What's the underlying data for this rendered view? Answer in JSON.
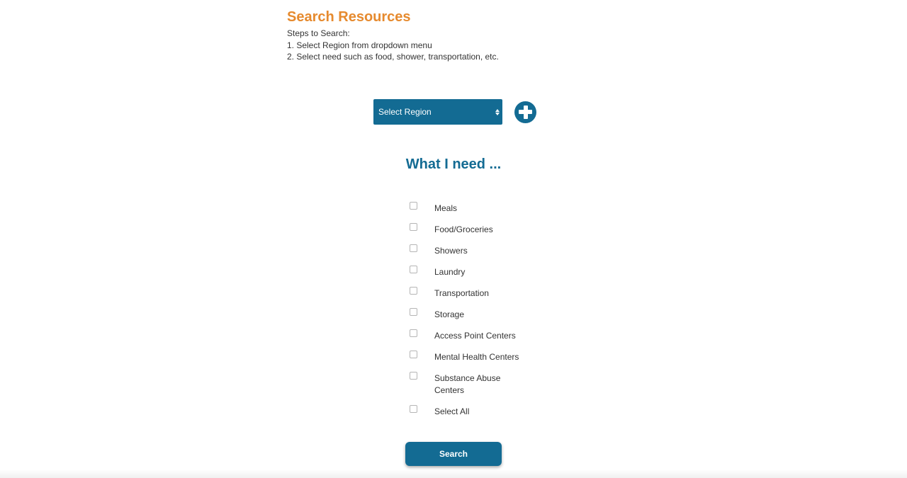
{
  "header": {
    "title": "Search Resources",
    "steps_heading": "Steps to Search:",
    "step_1": "1. Select Region from dropdown menu",
    "step_2": "2. Select need such as food, shower, transportation, etc."
  },
  "region_select": {
    "selected_value": "Select Region"
  },
  "icons": {
    "add": "plus-circle-icon",
    "select_arrows": "sort-arrows-icon"
  },
  "needs": {
    "title": "What I need ...",
    "items": [
      {
        "label": "Meals",
        "checked": false
      },
      {
        "label": "Food/Groceries",
        "checked": false
      },
      {
        "label": "Showers",
        "checked": false
      },
      {
        "label": "Laundry",
        "checked": false
      },
      {
        "label": "Transportation",
        "checked": false
      },
      {
        "label": "Storage",
        "checked": false
      },
      {
        "label": "Access Point Centers",
        "checked": false
      },
      {
        "label": "Mental Health Centers",
        "checked": false
      },
      {
        "label": "Substance Abuse Centers",
        "checked": false
      },
      {
        "label": "Select All",
        "checked": false
      }
    ]
  },
  "actions": {
    "search_label": "Search"
  },
  "colors": {
    "accent_orange": "#e68a2e",
    "brand_blue": "#136b93"
  }
}
